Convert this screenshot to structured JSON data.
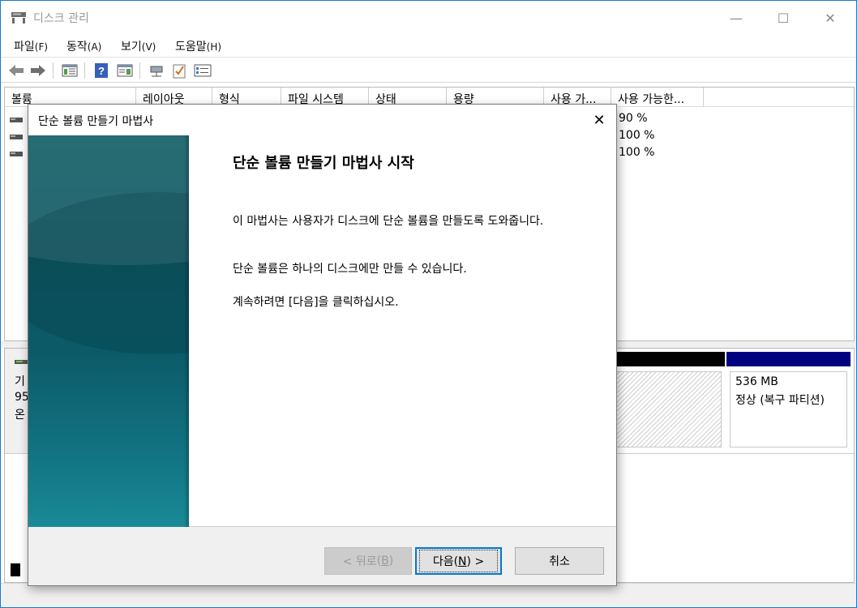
{
  "window": {
    "title": "디스크 관리",
    "minimize": "—",
    "maximize": "☐",
    "close": "✕"
  },
  "menu": [
    {
      "label": "파일",
      "accel": "(F)"
    },
    {
      "label": "동작",
      "accel": "(A)"
    },
    {
      "label": "보기",
      "accel": "(V)"
    },
    {
      "label": "도움말",
      "accel": "(H)"
    }
  ],
  "toolbar_icons": [
    "back-arrow-icon",
    "forward-arrow-icon",
    "console-tree-icon",
    "help-icon",
    "action-pane-icon",
    "connect-icon",
    "properties-check-icon",
    "settings-list-icon"
  ],
  "volume_table": {
    "columns": [
      "볼륨",
      "레이아웃",
      "형식",
      "파일 시스템",
      "상태",
      "용량",
      "사용 가...",
      "사용 가능한..."
    ],
    "rows": [
      {
        "free_pct": "90 %"
      },
      {
        "free_pct": "100 %"
      },
      {
        "free_pct": "100 %"
      }
    ]
  },
  "disk_map": {
    "label_lines": [
      "기",
      "95",
      "온"
    ],
    "partition": {
      "size": "536 MB",
      "status": "정상 (복구 파티션)"
    }
  },
  "dialog": {
    "title": "단순 볼륨 만들기 마법사",
    "close": "✕",
    "heading": "단순 볼륨 만들기 마법사 시작",
    "para1": "이 마법사는 사용자가 디스크에 단순 볼륨을 만들도록 도와줍니다.",
    "para2": "단순 볼륨은 하나의 디스크에만 만들 수 있습니다.",
    "para3": "계속하려면 [다음]을 클릭하십시오.",
    "buttons": {
      "back": {
        "label": "< 뒤로",
        "accel": "B",
        "enabled": false
      },
      "next": {
        "label": "다음",
        "accel": "N",
        "suffix": " >"
      },
      "cancel": {
        "label": "취소"
      }
    }
  },
  "colors": {
    "primary_partition_header": "#000000",
    "recovery_partition_header": "#000080",
    "default_button_border": "#0078d7"
  }
}
